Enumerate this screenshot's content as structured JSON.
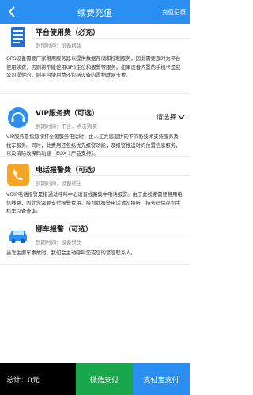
{
  "header": {
    "title": "续费充值",
    "record_label": "充值记录"
  },
  "items": [
    {
      "name": "平台使用费（必充）",
      "expiry_label": "到期时间：",
      "expiry_value": "设备终生",
      "desc": "GPS设备需要厂家租用服务器以提供数据存储和控制服务，因此需要及时为平台使用续费，否则将不能使用GPS定位和报警等服务。如果设备内置的手机卡是我公司提供的，则平台使用费还包括设备内置物联网卡费。"
    },
    {
      "name": "VIP服务费（可选）",
      "expiry_label": "到期时间：",
      "expiry_value": "不含，点击购买",
      "select_label": "请选择",
      "desc": "VIP服务是指您按打全国服务电话时，由人工为您提供的不间断技术支持服务及找车服务。同时，此费用还包括优先报警功能，及报警推送时的位置信息服务，以及清除故障码功能（BOX 1产品支持）。"
    },
    {
      "name": "电话报警费（可选）",
      "expiry_label": "到期时间：",
      "expiry_value": "设备终生",
      "desc": "VOIP电话报警是指通过呼叫中心语音线路集中电话报警。由于此线路需要租用电信线路，因此您需要支付报警费用。接到此报警电话请勿接听，持号码保存到手机里以备查询。"
    },
    {
      "name": "挪车报警（可选）",
      "expiry_label": "到期时间：",
      "expiry_value": "设备终生",
      "desc": "当发生挪车事故时，我们会主动呼叫您或您的紧急联系人。"
    }
  ],
  "footer": {
    "total_label": "总计：",
    "total_value": "0元",
    "wechat_label": "微信支付",
    "alipay_label": "支付宝支付"
  },
  "colors": {
    "primary": "#2a8ff0",
    "wechat": "#18a84b",
    "footer_dark": "#000000"
  },
  "icons": [
    "back-arrow-icon",
    "platform-fee-icon",
    "vip-service-icon",
    "phone-alarm-icon",
    "car-move-icon",
    "chevron-down-icon"
  ]
}
